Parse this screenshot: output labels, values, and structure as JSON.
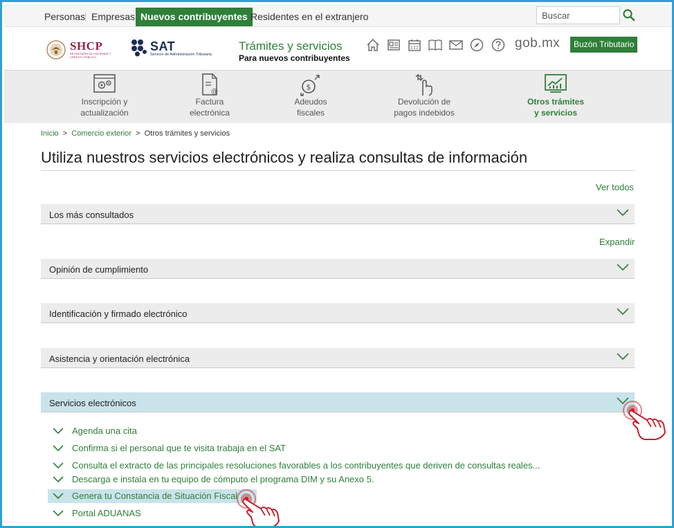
{
  "topnav": {
    "tabs": [
      {
        "label": "Personas",
        "active": false
      },
      {
        "label": "Empresas",
        "active": false
      },
      {
        "label": "Nuevos contribuyentes",
        "active": true
      },
      {
        "label": "Residentes en el extranjero",
        "active": false
      }
    ],
    "search_placeholder": "Buscar"
  },
  "header": {
    "shcp_name": "SHCP",
    "shcp_sub": "SECRETARÍA DE HACIENDA Y CRÉDITO PÚBLICO",
    "sat_name": "SAT",
    "sat_sub": "Servicio de Administración Tributaria",
    "title": "Trámites y servicios",
    "subtitle": "Para nuevos contribuyentes",
    "icons": [
      "home-icon",
      "news-icon",
      "calendar-icon",
      "book-icon",
      "mail-icon",
      "compass-icon",
      "help-icon"
    ],
    "gobmx": "gob.mx",
    "buzon": "Buzón Tributario"
  },
  "categories": [
    {
      "line1": "Inscripción y",
      "line2": "actualización",
      "icon": "settings-screen-icon",
      "active": false
    },
    {
      "line1": "Factura",
      "line2": "electrónica",
      "icon": "invoice-icon",
      "active": false
    },
    {
      "line1": "Adeudos",
      "line2": "fiscales",
      "icon": "coin-arrows-icon",
      "active": false
    },
    {
      "line1": "Devolución de",
      "line2": "pagos indebidos",
      "icon": "hand-arrows-icon",
      "active": false
    },
    {
      "line1": "Otros trámites",
      "line2": "y servicios",
      "icon": "chart-monitor-icon",
      "active": true
    }
  ],
  "breadcrumb": {
    "items": [
      "Inicio",
      "Comercio exterior"
    ],
    "separator": ">",
    "current": "Otros trámites y servicios"
  },
  "page_title": "Utiliza nuestros servicios electrónicos y realiza consultas de información",
  "ver_todos": "Ver todos",
  "expandir": "Expandir",
  "accordions": [
    {
      "label": "Los más consultados",
      "open": false
    },
    {
      "label": "Opinión de cumplimiento",
      "open": false
    },
    {
      "label": "Identificación y firmado electrónico",
      "open": false
    },
    {
      "label": "Asistencia y orientación electrónica",
      "open": false
    },
    {
      "label": "Servicios electrónicos",
      "open": true
    }
  ],
  "services": [
    {
      "label": "Agenda una cita",
      "highlighted": false
    },
    {
      "label": "Confirma si el personal que te visita trabaja en el SAT",
      "highlighted": false
    },
    {
      "label": "Consulta el extracto de las principales resoluciones favorables a los contribuyentes que deriven de consultas reales...",
      "highlighted": false
    },
    {
      "label": "Descarga e instala en tu equipo de cómputo el programa DIM y su Anexo 5.",
      "highlighted": false
    },
    {
      "label": "Genera tu Constancia de Situación Fiscal",
      "highlighted": true
    },
    {
      "label": "Portal ADUANAS",
      "highlighted": false
    }
  ],
  "colors": {
    "brand_green": "#2f7f39",
    "highlight_blue": "#c9e3ea",
    "frame_blue": "#2ea0d8",
    "hand_red": "#c8202b",
    "shcp_maroon": "#9b2247",
    "sat_navy": "#1b2d54"
  }
}
